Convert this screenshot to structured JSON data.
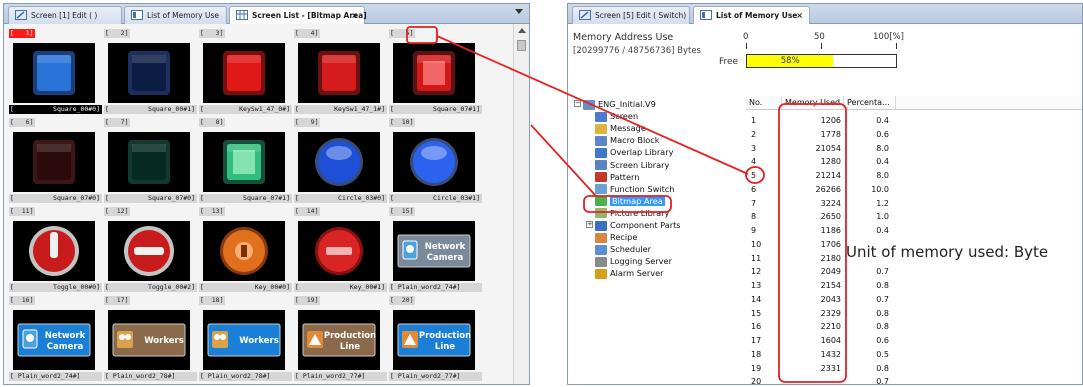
{
  "left_window": {
    "tabs": [
      {
        "label": "Screen [1] Edit (          )"
      },
      {
        "label": "List of Memory Use"
      },
      {
        "label": "Screen List - [Bitmap Area]",
        "close": "×"
      }
    ],
    "items": [
      {
        "num": "[   1]",
        "name": "Square_00#0]",
        "type": "square-blue"
      },
      {
        "num": "[   2]",
        "name": "Square_00#1]",
        "type": "square-navy"
      },
      {
        "num": "[   3]",
        "name": "KeySw1_47_0#]",
        "type": "square-red"
      },
      {
        "num": "[   4]",
        "name": "KeySw1_47_1#]",
        "type": "square-red2"
      },
      {
        "num": "[   5]",
        "name": "Square_07#1]",
        "type": "square-glow-red"
      },
      {
        "num": "[   6]",
        "name": "Square_07#0]",
        "type": "square-dark-red"
      },
      {
        "num": "[   7]",
        "name": "Square_07#0]",
        "type": "square-dark-green"
      },
      {
        "num": "[   8]",
        "name": "Square_07#1]",
        "type": "square-green"
      },
      {
        "num": "[   9]",
        "name": "Circle_03#0]",
        "type": "circle-blue"
      },
      {
        "num": "[  10]",
        "name": "Circle_03#1]",
        "type": "circle-blue2"
      },
      {
        "num": "[  11]",
        "name": "Toggle_00#0]",
        "type": "toggle-v"
      },
      {
        "num": "[  12]",
        "name": "Toggle_00#2]",
        "type": "toggle-h"
      },
      {
        "num": "[  13]",
        "name": "Key_00#0]",
        "type": "key-orange"
      },
      {
        "num": "[  14]",
        "name": "Key_00#1]",
        "type": "key-red"
      },
      {
        "num": "[  15]",
        "name": "[ Plain_word2_74#]",
        "type": "network-camera",
        "text1": "Network",
        "text2": "Camera"
      },
      {
        "num": "[  16]",
        "name": "[ Plain_word2_74#]",
        "type": "network-camera-blue",
        "text1": "Network",
        "text2": "Camera"
      },
      {
        "num": "[  17]",
        "name": "[ Plain_word2_78#]",
        "type": "workers-brown",
        "text1": "Workers"
      },
      {
        "num": "[  18]",
        "name": "[ Plain_word2_78#]",
        "type": "workers-blue",
        "text1": "Workers"
      },
      {
        "num": "[  19]",
        "name": "[ Plain_word2_77#]",
        "type": "production-brown",
        "text1": "Production",
        "text2": "Line"
      },
      {
        "num": "[  20]",
        "name": "[ Plain_word2_77#]",
        "type": "production-blue",
        "text1": "Production",
        "text2": "Line"
      }
    ]
  },
  "right_window": {
    "tabs": [
      {
        "label": "Screen [5] Edit (     Switch)"
      },
      {
        "label": "List of Memory Use",
        "close": "×"
      }
    ],
    "memory": {
      "title": "Memory Address Use",
      "bytes": "[20299776 / 48756736] Bytes",
      "scale": [
        "0",
        "50",
        "100[%]"
      ],
      "free_label": "Free",
      "free_percent": 58,
      "free_percent_text": "58%"
    },
    "tree": [
      {
        "label": "ENG_Initial.V9",
        "level": 0,
        "icon": "project-icon",
        "color": "#6b8fc7"
      },
      {
        "label": "Screen",
        "level": 1,
        "icon": "screen-icon",
        "color": "#4a7bd0"
      },
      {
        "label": "Message",
        "level": 1,
        "icon": "message-icon",
        "color": "#e0b43c"
      },
      {
        "label": "Macro Block",
        "level": 1,
        "icon": "macro-block-icon",
        "color": "#5b86c9"
      },
      {
        "label": "Overlap Library",
        "level": 1,
        "icon": "overlap-library-icon",
        "color": "#3f78c9"
      },
      {
        "label": "Screen Library",
        "level": 1,
        "icon": "screen-library-icon",
        "color": "#5c83c2"
      },
      {
        "label": "Pattern",
        "level": 1,
        "icon": "pattern-icon",
        "color": "#c0392b"
      },
      {
        "label": "Function Switch",
        "level": 1,
        "icon": "function-switch-icon",
        "color": "#6a9fd8"
      },
      {
        "label": "Bitmap Area",
        "level": 1,
        "icon": "bitmap-area-icon",
        "color": "#4caf50",
        "highlight": true
      },
      {
        "label": "Picture Library",
        "level": 1,
        "icon": "picture-library-icon",
        "color": "#8fb86e"
      },
      {
        "label": "Component Parts",
        "level": 1,
        "icon": "component-parts-icon",
        "color": "#3a6fc2",
        "expander": "+"
      },
      {
        "label": "Recipe",
        "level": 1,
        "icon": "recipe-icon",
        "color": "#d9873c"
      },
      {
        "label": "Scheduler",
        "level": 1,
        "icon": "scheduler-icon",
        "color": "#5a8fd3"
      },
      {
        "label": "Logging Server",
        "level": 1,
        "icon": "logging-server-icon",
        "color": "#8a8a8a"
      },
      {
        "label": "Alarm Server",
        "level": 1,
        "icon": "alarm-server-icon",
        "color": "#d4a017"
      }
    ],
    "table": {
      "headers": [
        "No.",
        "Memory Used",
        "Percenta..."
      ],
      "rows": [
        {
          "no": "1",
          "mem": "1206",
          "pct": "0.4"
        },
        {
          "no": "2",
          "mem": "1778",
          "pct": "0.6"
        },
        {
          "no": "3",
          "mem": "21054",
          "pct": "8.0"
        },
        {
          "no": "4",
          "mem": "1280",
          "pct": "0.4"
        },
        {
          "no": "5",
          "mem": "21214",
          "pct": "8.0"
        },
        {
          "no": "6",
          "mem": "26266",
          "pct": "10.0"
        },
        {
          "no": "7",
          "mem": "3224",
          "pct": "1.2"
        },
        {
          "no": "8",
          "mem": "2650",
          "pct": "1.0"
        },
        {
          "no": "9",
          "mem": "1186",
          "pct": "0.4"
        },
        {
          "no": "10",
          "mem": "1706",
          "pct": ""
        },
        {
          "no": "11",
          "mem": "2180",
          "pct": ""
        },
        {
          "no": "12",
          "mem": "2049",
          "pct": "0.7"
        },
        {
          "no": "13",
          "mem": "2154",
          "pct": "0.8"
        },
        {
          "no": "14",
          "mem": "2043",
          "pct": "0.7"
        },
        {
          "no": "15",
          "mem": "2329",
          "pct": "0.8"
        },
        {
          "no": "16",
          "mem": "2210",
          "pct": "0.8"
        },
        {
          "no": "17",
          "mem": "1604",
          "pct": "0.6"
        },
        {
          "no": "18",
          "mem": "1432",
          "pct": "0.5"
        },
        {
          "no": "19",
          "mem": "2331",
          "pct": "0.8"
        },
        {
          "no": "20",
          "mem": "",
          "pct": "0.7"
        }
      ]
    }
  },
  "annotation": {
    "unit_note": "Unit of memory used: Byte",
    "color": "#e52020"
  }
}
